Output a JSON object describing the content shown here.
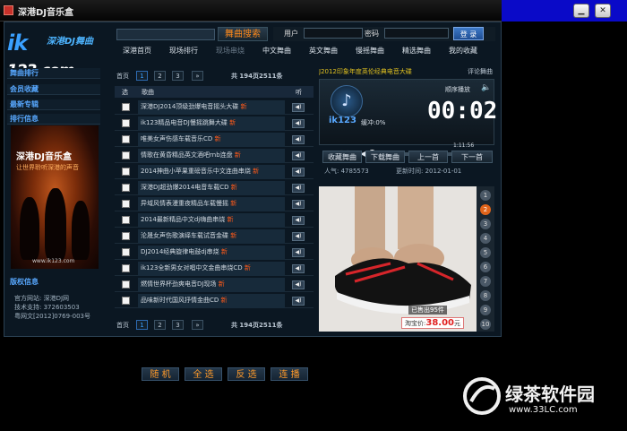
{
  "window": {
    "title": "深港DJ音乐盒",
    "min_label": "▁",
    "close_label": "✕"
  },
  "logo": {
    "prefix": "ik",
    "suffix": "123.com",
    "tagline": "深港DJ舞曲"
  },
  "search": {
    "button_label": "舞曲搜索",
    "placeholder": ""
  },
  "login": {
    "user_label": "用户",
    "password_label": "密码",
    "login_button": "登 录"
  },
  "nav": [
    "深港首页",
    "现场排行",
    "现场串烧",
    "中文舞曲",
    "英文舞曲",
    "慢摇舞曲",
    "精选舞曲",
    "我的收藏"
  ],
  "sidebar": {
    "menu": [
      "舞曲排行",
      "会员收藏",
      "最新专辑",
      "排行信息"
    ],
    "promo_title": "深港DJ音乐盒",
    "promo_subtitle": "让世界聆听深港的声音",
    "promo_url": "www.ik123.com",
    "copyright_title": "版权信息",
    "copyright_lines": [
      "官方网站: 深港DJ网",
      "技术支持: 372603503",
      "粤网文[2012]0769-003号"
    ]
  },
  "pager": {
    "home": "首页",
    "pages": [
      "1",
      "2",
      "3"
    ],
    "next": "»",
    "summary": "共 194页2511条"
  },
  "list_header": {
    "select": "选",
    "title": "歌曲",
    "listen": "听"
  },
  "songs": [
    {
      "title": "深港DJ2014顶级劲爆电音摇头大碟",
      "new": "新"
    },
    {
      "title": "ik123精品电音DJ慢摇跳舞大碟",
      "new": "新"
    },
    {
      "title": "唯美女声伤感车载音乐CD",
      "new": "新"
    },
    {
      "title": "情歌在黄昏精品英文酒吧rnb连盘",
      "new": "新"
    },
    {
      "title": "2014抻曲小苹果重磅音乐中文连曲串烧",
      "new": "新"
    },
    {
      "title": "深港DJ超劲爆2014电音车载CD",
      "new": "新"
    },
    {
      "title": "异域风情表漫重夜精品车载慢摇",
      "new": "新"
    },
    {
      "title": "2014最新精品中文dj嗨曲串烧",
      "new": "新"
    },
    {
      "title": "沦晟女声伤歌演绎车载试音金碟",
      "new": "新"
    },
    {
      "title": "DJ2014经典旋律电鼓dj串烧",
      "new": "新"
    },
    {
      "title": "ik123全新男女对唱中文金曲串烧CD",
      "new": "新"
    },
    {
      "title": "燃情世界杯劲爽电音DJ现场",
      "new": "新"
    },
    {
      "title": "品味新时代国风抒情金曲CD",
      "new": "新"
    }
  ],
  "actions": [
    "随 机",
    "全 选",
    "反 选",
    "连 播"
  ],
  "player": {
    "ticker": "J2012印象年度英伦经典电音大碟",
    "comment_link": "评论舞曲",
    "logo": "ik123",
    "buffer": "缓冲:0%",
    "play_mode": "顺序播放",
    "time": "00:02",
    "duration": "1:11:56",
    "progress": 0.03,
    "buttons": [
      "收藏舞曲",
      "下载舞曲",
      "上一首",
      "下一首"
    ],
    "popularity": "人气: 4785573",
    "updated": "更新时间: 2012-01-01"
  },
  "ad": {
    "sold": "已售出95件",
    "price_label": "淘宝价:",
    "price_value": "38.00",
    "price_unit": "元",
    "page_numbers": [
      "1",
      "2",
      "3",
      "4",
      "5",
      "6",
      "7",
      "8",
      "9",
      "10"
    ],
    "current_page": "2"
  },
  "watermark": {
    "name": "绿茶软件园",
    "url": "www.33LC.com"
  },
  "colors": {
    "accent_blue": "#3aa0ff",
    "accent_orange": "#ff8a1a",
    "new_badge": "#ff5a1a",
    "window_ctrl_bg": "#0a0ac8"
  }
}
